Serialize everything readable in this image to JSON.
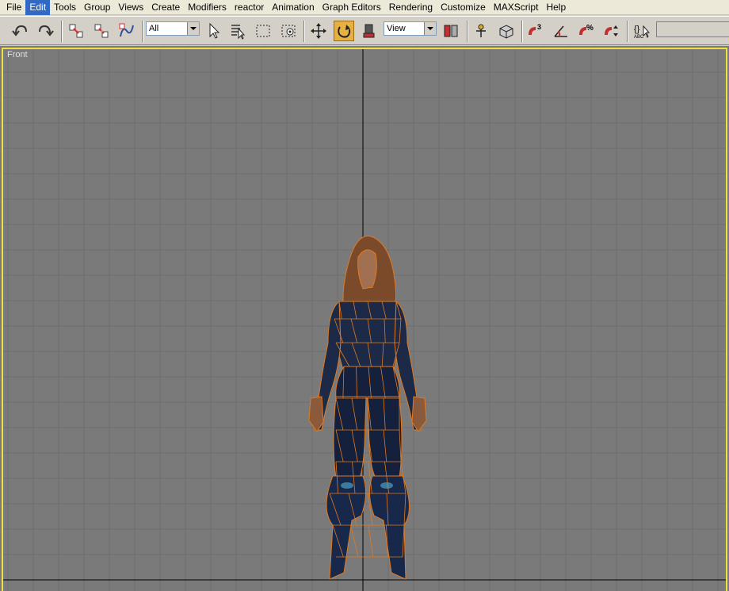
{
  "menu": {
    "items": [
      {
        "label": "File"
      },
      {
        "label": "Edit"
      },
      {
        "label": "Tools"
      },
      {
        "label": "Group"
      },
      {
        "label": "Views"
      },
      {
        "label": "Create"
      },
      {
        "label": "Modifiers"
      },
      {
        "label": "reactor"
      },
      {
        "label": "Animation"
      },
      {
        "label": "Graph Editors"
      },
      {
        "label": "Rendering"
      },
      {
        "label": "Customize"
      },
      {
        "label": "MAXScript"
      },
      {
        "label": "Help"
      }
    ],
    "active": "Edit"
  },
  "toolbar": {
    "selection_filter": "All",
    "reference_coordinate_system": "View",
    "angle_snap_label": "3",
    "percent_snap_label": "%",
    "edit_named_selection_label": "ABC",
    "named_selection_value": ""
  },
  "viewport": {
    "label": "Front",
    "active_border_color": "#f0e040",
    "background_color": "#7a7a7a",
    "grid_color": "#6e6e6e",
    "axis_color": "#000000",
    "wireframe_color": "#e07a20"
  }
}
